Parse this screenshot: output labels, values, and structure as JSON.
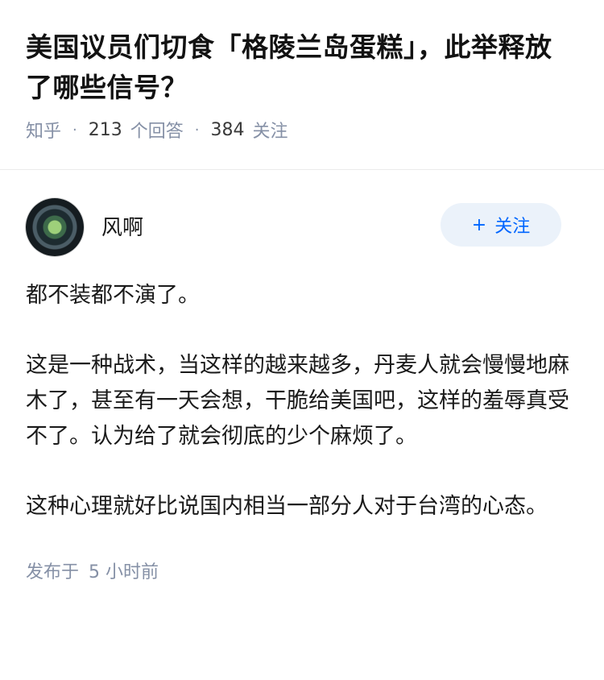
{
  "question": {
    "title": "美国议员们切食「格陵兰岛蛋糕」，此举释放了哪些信号？",
    "source": "知乎",
    "answers_count": "213",
    "answers_label": "个回答",
    "followers_count": "384",
    "followers_label": "关注"
  },
  "answer": {
    "author_name": "风啊",
    "follow_button": "关注",
    "follow_icon": "plus-icon",
    "paragraphs": [
      "都不装都不演了。",
      "这是一种战术，当这样的越来越多，丹麦人就会慢慢地麻木了，甚至有一天会想，干脆给美国吧，这样的羞辱真受不了。认为给了就会彻底的少个麻烦了。",
      "这种心理就好比说国内相当一部分人对于台湾的心态。"
    ],
    "posted_prefix": "发布于",
    "posted_time": "5 小时前"
  },
  "colors": {
    "accent": "#0066ff",
    "follow_bg": "#ebf2fa",
    "meta_gray": "#8590a6"
  }
}
